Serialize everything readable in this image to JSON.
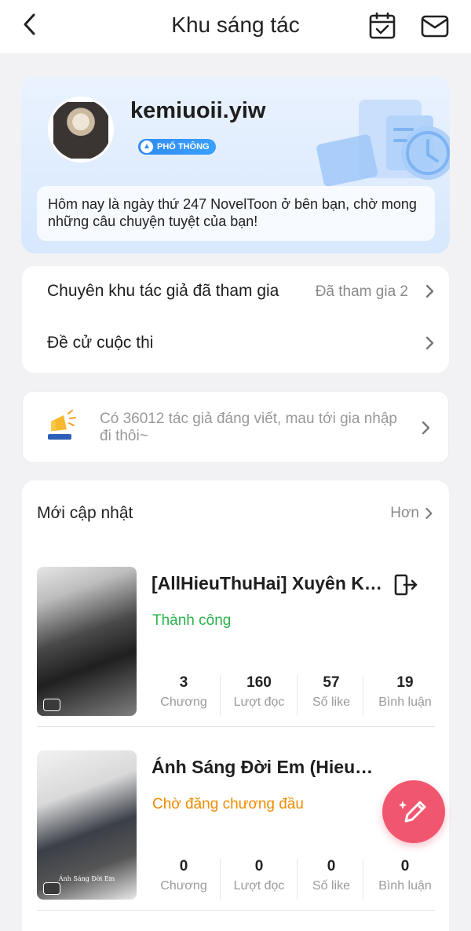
{
  "header": {
    "title": "Khu sáng tác",
    "back_icon": "chevron-left-icon",
    "calendar_icon": "calendar-check-icon",
    "mail_icon": "mail-icon"
  },
  "profile": {
    "username": "kemiuoii.yiw",
    "badge": "PHỔ THÔNG",
    "greeting": "Hôm nay là ngày thứ 247 NovelToon ở bên bạn, chờ mong những câu chuyện tuyệt của bạn!"
  },
  "menu": {
    "items": [
      {
        "label": "Chuyên khu tác giả đã tham gia",
        "value": "Đã tham gia 2"
      },
      {
        "label": "Đề cử cuộc thi",
        "value": ""
      }
    ]
  },
  "invite": {
    "text": "Có 36012 tác giả đáng viết, mau tới gia nhập đi thôi~"
  },
  "works": {
    "section_title": "Mới cập nhật",
    "more_label": "Hơn",
    "items": [
      {
        "title": "[AllHieuThuHai] Xuyên Khô...",
        "status": "Thành công",
        "status_color": "#2bb24c",
        "cover_caption": "",
        "stats": [
          {
            "value": "3",
            "label": "Chương"
          },
          {
            "value": "160",
            "label": "Lượt đọc"
          },
          {
            "value": "57",
            "label": "Số like"
          },
          {
            "value": "19",
            "label": "Bình luận"
          }
        ]
      },
      {
        "title": "Ánh Sáng Đời Em (HieuGav)",
        "status": "Chờ đăng chương đầu",
        "status_color": "#f08c00",
        "cover_caption": "Ánh Sáng Đời Em",
        "stats": [
          {
            "value": "0",
            "label": "Chương"
          },
          {
            "value": "0",
            "label": "Lượt đọc"
          },
          {
            "value": "0",
            "label": "Số like"
          },
          {
            "value": "0",
            "label": "Bình luận"
          }
        ]
      }
    ]
  },
  "fab": {
    "icon": "pencil-sparkle-icon",
    "color": "#f0576f"
  }
}
